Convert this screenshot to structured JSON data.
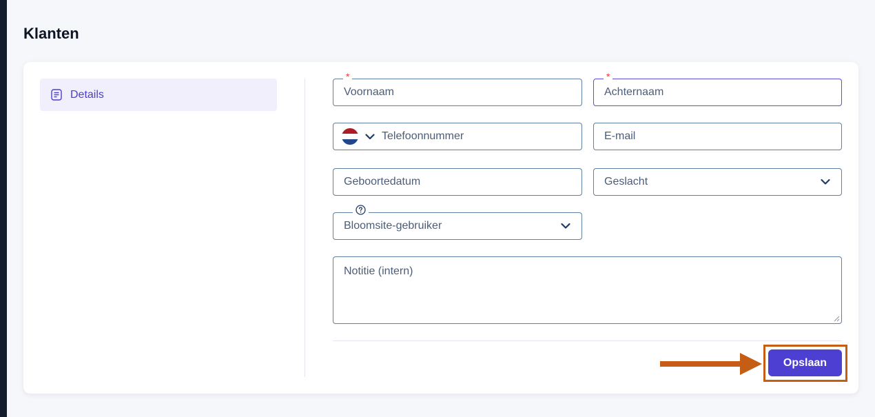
{
  "page": {
    "title": "Klanten"
  },
  "sidebar": {
    "items": [
      {
        "label": "Details",
        "icon": "document-list-icon",
        "active": true
      }
    ]
  },
  "form": {
    "voornaam": {
      "placeholder": "Voornaam",
      "required_mark": "*"
    },
    "achternaam": {
      "placeholder": "Achternaam",
      "required_mark": "*"
    },
    "telefoon": {
      "placeholder": "Telefoonnummer",
      "country_flag": "netherlands-flag-icon"
    },
    "email": {
      "placeholder": "E-mail"
    },
    "geboortedatum": {
      "placeholder": "Geboortedatum"
    },
    "geslacht": {
      "placeholder": "Geslacht",
      "icon": "chevron-down-icon"
    },
    "bloomsite_gebruiker": {
      "placeholder": "Bloomsite-gebruiker",
      "help_icon": "question-circle-icon"
    },
    "notitie": {
      "placeholder": "Notitie (intern)"
    }
  },
  "actions": {
    "save_label": "Opslaan"
  },
  "colors": {
    "primary": "#4e3fd3",
    "annotation": "#c65d15",
    "field_border": "#5e7fa3",
    "required": "#e53935",
    "sidebar_active_bg": "#f1effc"
  }
}
